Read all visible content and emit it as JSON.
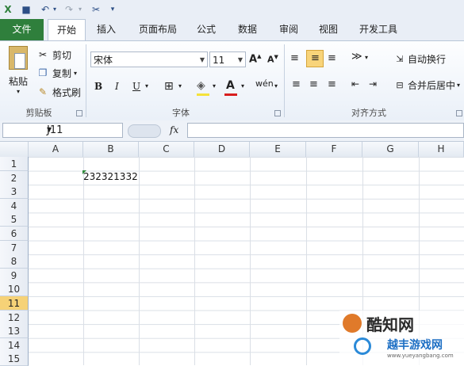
{
  "tabs": [
    "文件",
    "开始",
    "插入",
    "页面布局",
    "公式",
    "数据",
    "审阅",
    "视图",
    "开发工具"
  ],
  "clipboard": {
    "paste": "粘贴",
    "cut": "剪切",
    "copy": "复制",
    "format_painter": "格式刷",
    "label": "剪贴板"
  },
  "font": {
    "name": "宋体",
    "size": "11",
    "bold": "B",
    "italic": "I",
    "underline": "U",
    "label": "字体"
  },
  "align": {
    "wrap": "自动换行",
    "merge": "合并后居中",
    "label": "对齐方式"
  },
  "name_box": "J11",
  "fx": "fx",
  "columns": [
    "A",
    "B",
    "C",
    "D",
    "E",
    "F",
    "G",
    "H"
  ],
  "rows": [
    "1",
    "2",
    "3",
    "4",
    "5",
    "6",
    "7",
    "8",
    "9",
    "10",
    "11",
    "12",
    "13",
    "14",
    "15"
  ],
  "cell_b2": "232321332",
  "watermark": {
    "line1": "酷知网",
    "line2": "越丰游戏网",
    "url": "www.yueyangbang.com"
  },
  "colors": {
    "file_tab": "#2f7f3c",
    "selected_row": "#f6d277"
  }
}
